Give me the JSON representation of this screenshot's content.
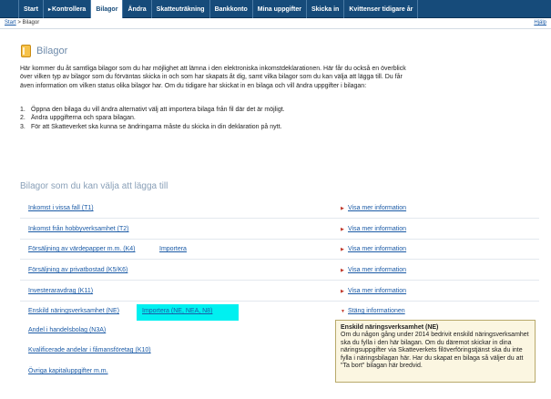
{
  "nav": {
    "items": [
      {
        "label": "Start",
        "arrow": ""
      },
      {
        "label": "Kontrollera",
        "arrow": "▸"
      },
      {
        "label": "Bilagor",
        "arrow": ""
      },
      {
        "label": "Ändra",
        "arrow": ""
      },
      {
        "label": "Skatteuträkning",
        "arrow": ""
      },
      {
        "label": "Bankkonto",
        "arrow": ""
      },
      {
        "label": "Mina uppgifter",
        "arrow": ""
      },
      {
        "label": "Skicka in",
        "arrow": ""
      },
      {
        "label": "Kvittenser tidigare år",
        "arrow": ""
      }
    ],
    "active_index": 2
  },
  "breadcrumb": {
    "home": "Start",
    "separator": ">",
    "current": "Bilagor"
  },
  "help_label": "Hjälp",
  "page": {
    "title": "Bilagor",
    "intro": "Här kommer du åt samtliga bilagor som du har möjlighet att lämna i den elektroniska inkomstdeklarationen. Här får du också en överblick över vilken typ av bilagor som du förväntas skicka in och som har skapats åt dig, samt vilka bilagor som du kan välja att lägga till. Du får även information om vilken status olika bilagor har. Om du tidigare har skickat in en bilaga och vill ändra uppgifter i bilagan:",
    "steps": [
      {
        "num": "1.",
        "text": "Öppna den bilaga du vill ändra alternativt välj att importera bilaga från fil där det är möjligt."
      },
      {
        "num": "2.",
        "text": "Ändra uppgifterna och spara bilagan."
      },
      {
        "num": "3.",
        "text": "För att Skatteverket ska kunna se ändringarna måste du skicka in din deklaration på nytt."
      }
    ],
    "section_title": "Bilagor som du kan välja att lägga till"
  },
  "attachments": {
    "show_more": "Visa mer information",
    "close_info": "Stäng informationen",
    "import": "Importera",
    "rows": [
      {
        "label": "Inkomst i vissa fall (T1)",
        "extra": ""
      },
      {
        "label": "Inkomst från hobbyverksamhet (T2)",
        "extra": ""
      },
      {
        "label": "Försäljning av värdepapper m.m. (K4)",
        "extra": "Importera"
      },
      {
        "label": "Försäljning av privatbostad (K5/K6)",
        "extra": ""
      },
      {
        "label": "Investeraravdrag (K11)",
        "extra": ""
      },
      {
        "label": "Enskild näringsverksamhet (NE)",
        "extra": "Importera (NE, NEA, N8)"
      },
      {
        "label": "Andel i handelsbolag (N3A)",
        "extra": ""
      },
      {
        "label": "Kvalificerade andelar i fåmansföretag (K10)",
        "extra": ""
      },
      {
        "label": "Övriga kapitaluppgifter m.m.",
        "extra": ""
      }
    ]
  },
  "info_box": {
    "title": "Enskild näringsverksamhet (NE)",
    "text": "Om du någon gång under 2014 bedrivit enskild näringsverksamhet ska du fylla i den här bilagan. Om du däremot skickar in dina näringsuppgifter via Skatteverkets filöverföringstjänst ska du inte fylla i näringsbilagan här. Har du skapat en bilaga så väljer du att \"Ta bort\" bilagan här bredvid."
  },
  "colors": {
    "nav_bg": "#164b7a",
    "link": "#1a5aa6",
    "highlight": "#00f0f0",
    "info_bg": "#fbf6e1",
    "bullet": "#c0392b"
  },
  "icons": {
    "title": "lightbulb-icon",
    "expand": "triangle-right-icon",
    "collapse": "triangle-down-icon"
  }
}
